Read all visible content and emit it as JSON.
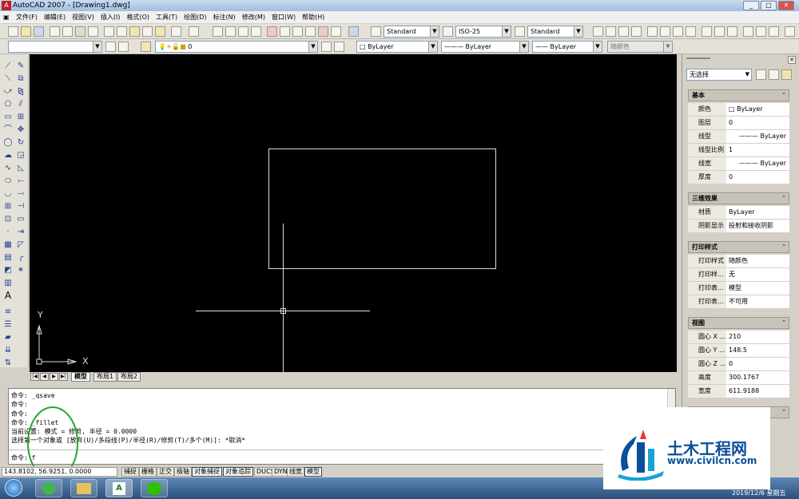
{
  "window": {
    "title": "AutoCAD 2007 - [Drawing1.dwg]",
    "min": "_",
    "max": "□",
    "close": "✕"
  },
  "menu": [
    "文件(F)",
    "编辑(E)",
    "视图(V)",
    "插入(I)",
    "格式(O)",
    "工具(T)",
    "绘图(D)",
    "标注(N)",
    "修改(M)",
    "窗口(W)",
    "帮助(H)"
  ],
  "styles": {
    "text_style": "Standard",
    "dim_style": "ISO-25",
    "table_style": "Standard"
  },
  "layers": {
    "current": "0"
  },
  "properties_bar": {
    "color": "ByLayer",
    "linetype": "ByLayer",
    "lineweight": "ByLayer",
    "plotstyle": "随颜色"
  },
  "tabs": {
    "model": "模型",
    "layout1": "布局1",
    "layout2": "布局2"
  },
  "ucs": {
    "x": "X",
    "y": "Y"
  },
  "command_lines": [
    "命令: _qsave",
    "命令:",
    "命令:",
    "命令: _fillet",
    "当前设置: 模式 = 修剪, 半径 = 0.0000",
    "选择第一个对象或 [放弃(U)/多段线(P)/半径(R)/修剪(T)/多个(M)]: *取消*"
  ],
  "command_prompt": "命令: f",
  "status": {
    "coords": "143.8102, 56.9251, 0.0000",
    "buttons": [
      "捕捉",
      "栅格",
      "正交",
      "极轴",
      "对象捕捉",
      "对象追踪",
      "DUCS",
      "DYN",
      "线宽",
      "模型"
    ]
  },
  "props_panel": {
    "selection": "无选择",
    "sections": {
      "basic": {
        "title": "基本",
        "rows": [
          {
            "k": "颜色",
            "v": "□ ByLayer"
          },
          {
            "k": "图层",
            "v": "0"
          },
          {
            "k": "线型",
            "v": "——— ByLayer"
          },
          {
            "k": "线型比例",
            "v": "1"
          },
          {
            "k": "线宽",
            "v": "——— ByLayer"
          },
          {
            "k": "厚度",
            "v": "0"
          }
        ]
      },
      "effects3d": {
        "title": "三维效果",
        "rows": [
          {
            "k": "材质",
            "v": "ByLayer"
          },
          {
            "k": "阴影显示",
            "v": "投射和接收阴影"
          }
        ]
      },
      "plot": {
        "title": "打印样式",
        "rows": [
          {
            "k": "打印样式",
            "v": "随颜色"
          },
          {
            "k": "打印样...",
            "v": "无"
          },
          {
            "k": "打印表...",
            "v": "模型"
          },
          {
            "k": "打印表...",
            "v": "不可用"
          }
        ]
      },
      "view": {
        "title": "视图",
        "rows": [
          {
            "k": "圆心 X ...",
            "v": "210"
          },
          {
            "k": "圆心 Y ...",
            "v": "148.5"
          },
          {
            "k": "圆心 Z ...",
            "v": "0"
          },
          {
            "k": "高度",
            "v": "300.1767"
          },
          {
            "k": "宽度",
            "v": "611.9188"
          }
        ]
      }
    }
  },
  "watermark": {
    "name": "土木工程网",
    "url": "www.civilcn.com"
  },
  "clock": {
    "date": "2019/12/6 星期五"
  },
  "colors": {
    "canvas": "#000000",
    "annotation_circle": "#22a832",
    "watermark_text": "#0a4f9a"
  }
}
